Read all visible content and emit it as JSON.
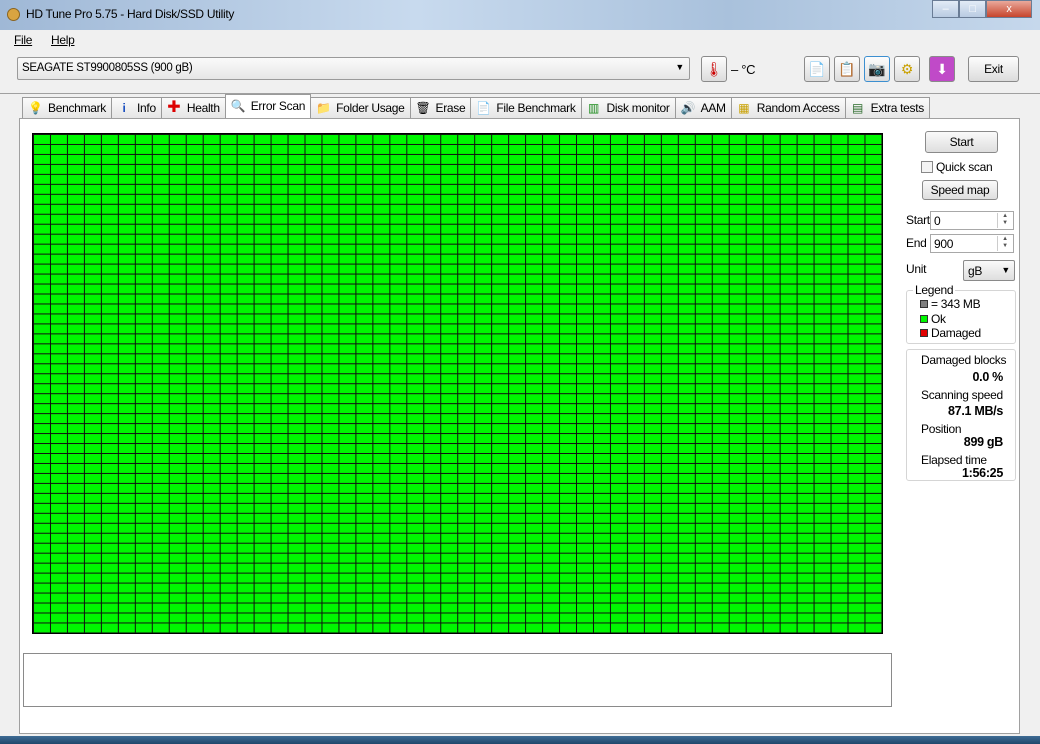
{
  "window": {
    "title": "HD Tune Pro 5.75 - Hard Disk/SSD Utility",
    "minimize": "–",
    "maximize": "□",
    "close": "x"
  },
  "menu": {
    "file": "File",
    "help": "Help"
  },
  "toolbar": {
    "drive": "SEAGATE ST9900805SS (900 gB)",
    "temperature": "– °C",
    "exit": "Exit"
  },
  "tabs": [
    {
      "label": "Benchmark",
      "icon": "bulb-icon"
    },
    {
      "label": "Info",
      "icon": "info-icon"
    },
    {
      "label": "Health",
      "icon": "health-cross-icon"
    },
    {
      "label": "Error Scan",
      "icon": "magnifier-icon"
    },
    {
      "label": "Folder Usage",
      "icon": "folder-icon"
    },
    {
      "label": "Erase",
      "icon": "trash-icon"
    },
    {
      "label": "File Benchmark",
      "icon": "file-benchmark-icon"
    },
    {
      "label": "Disk monitor",
      "icon": "disk-monitor-icon"
    },
    {
      "label": "AAM",
      "icon": "speaker-icon"
    },
    {
      "label": "Random Access",
      "icon": "random-access-icon"
    },
    {
      "label": "Extra tests",
      "icon": "extra-tests-icon"
    }
  ],
  "active_tab": "Error Scan",
  "scan": {
    "grid_columns": 50,
    "grid_rows": 50,
    "blocks_ok_fraction": 1.0,
    "ok_color": "#00f700",
    "damaged_color": "#e00000"
  },
  "side": {
    "start_button": "Start",
    "quick_scan": "Quick scan",
    "quick_scan_checked": false,
    "speed_map": "Speed map",
    "start_label": "Start",
    "start_value": "0",
    "end_label": "End",
    "end_value": "900",
    "unit_label": "Unit",
    "unit_value": "gB",
    "legend_title": "Legend",
    "legend_block": "= 343 MB",
    "legend_ok": "Ok",
    "legend_damaged": "Damaged",
    "damaged_blocks_label": "Damaged blocks",
    "damaged_blocks": "0.0 %",
    "speed_label": "Scanning speed",
    "speed": "87.1 MB/s",
    "position_label": "Position",
    "position": "899 gB",
    "elapsed_label": "Elapsed time",
    "elapsed": "1:56:25"
  }
}
